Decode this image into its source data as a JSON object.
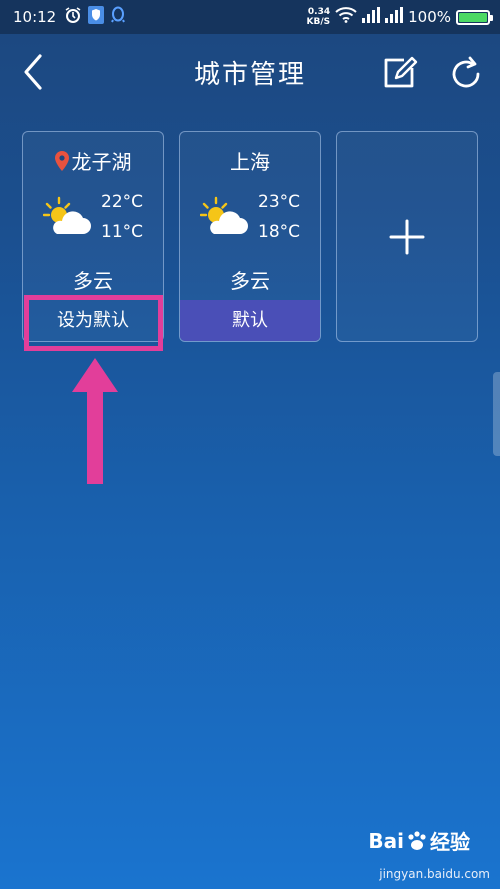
{
  "status_bar": {
    "time": "10:12",
    "net_speed_value": "0.34",
    "net_speed_unit": "KB/S",
    "battery_percent": "100%",
    "battery_level": 1.0
  },
  "header": {
    "title": "城市管理"
  },
  "cities": [
    {
      "name": "龙子湖",
      "is_current_location": true,
      "temp_high": "22°C",
      "temp_low": "11°C",
      "condition": "多云",
      "weather_icon": "partly-cloudy-icon",
      "default_label": "设为默认",
      "is_default": false
    },
    {
      "name": "上海",
      "is_current_location": false,
      "temp_high": "23°C",
      "temp_low": "18°C",
      "condition": "多云",
      "weather_icon": "partly-cloudy-icon",
      "default_label": "默认",
      "is_default": true
    }
  ],
  "add_city_icon": "plus-icon",
  "watermark": {
    "brand_a": "Bai",
    "brand_b": "经验",
    "url": "jingyan.baidu.com"
  },
  "colors": {
    "background_top": "#1c477e",
    "background_bottom": "#1a74cf",
    "default_badge": "#4a4fb7",
    "highlight": "#e23e9a",
    "location_pin": "#e8523f"
  }
}
